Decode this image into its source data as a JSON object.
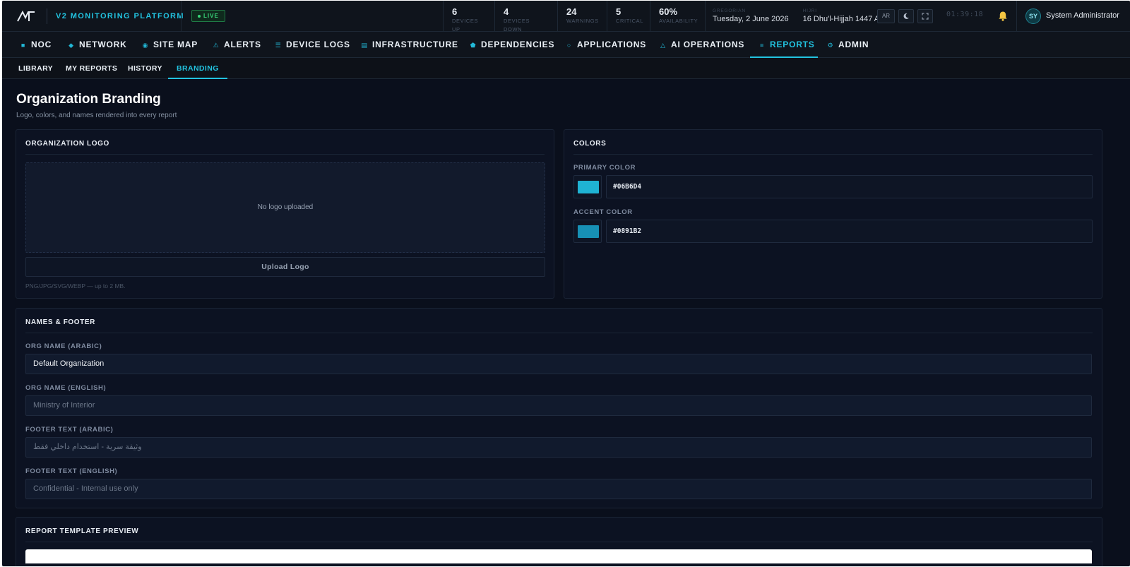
{
  "header": {
    "brand": "V2 MONITORING PLATFORM",
    "live_label": "LIVE",
    "stats": [
      {
        "value": "6",
        "label": "DEVICES UP"
      },
      {
        "value": "4",
        "label": "DEVICES DOWN"
      },
      {
        "value": "24",
        "label": "WARNINGS"
      },
      {
        "value": "5",
        "label": "CRITICAL"
      },
      {
        "value": "60%",
        "label": "AVAILABILITY"
      }
    ],
    "gregorian_label": "GREGORIAN",
    "gregorian_date": "Tuesday, 2 June 2026",
    "hijri_label": "HIJRI",
    "hijri_date": "16 Dhu'l-Hijjah 1447 AH",
    "lang_button": "AR",
    "clock": "01:39:18",
    "avatar_initials": "SY",
    "user_name": "System Administrator"
  },
  "nav": {
    "items": [
      {
        "label": "NOC",
        "icon": "square-icon"
      },
      {
        "label": "NETWORK",
        "icon": "diamond-icon"
      },
      {
        "label": "SITE MAP",
        "icon": "target-icon"
      },
      {
        "label": "ALERTS",
        "icon": "warning-icon"
      },
      {
        "label": "DEVICE LOGS",
        "icon": "list-icon"
      },
      {
        "label": "INFRASTRUCTURE",
        "icon": "server-icon"
      },
      {
        "label": "DEPENDENCIES",
        "icon": "pentagon-icon"
      },
      {
        "label": "APPLICATIONS",
        "icon": "circle-icon"
      },
      {
        "label": "AI OPERATIONS",
        "icon": "triangle-icon"
      },
      {
        "label": "REPORTS",
        "icon": "report-icon"
      },
      {
        "label": "ADMIN",
        "icon": "gear-icon"
      }
    ],
    "active": "REPORTS"
  },
  "subnav": {
    "items": [
      "LIBRARY",
      "MY REPORTS",
      "HISTORY",
      "BRANDING"
    ],
    "active": "BRANDING"
  },
  "page": {
    "title": "Organization Branding",
    "subtitle": "Logo, colors, and names rendered into every report"
  },
  "logo_card": {
    "heading": "ORGANIZATION LOGO",
    "empty_text": "No logo uploaded",
    "upload_label": "Upload Logo",
    "hint": "PNG/JPG/SVG/WEBP — up to 2 MB."
  },
  "colors_card": {
    "heading": "COLORS",
    "primary_label": "PRIMARY COLOR",
    "primary_value": "#06B6D4",
    "accent_label": "ACCENT COLOR",
    "accent_value": "#0891B2"
  },
  "names_card": {
    "heading": "NAMES & FOOTER",
    "org_ar_label": "ORG NAME (ARABIC)",
    "org_ar_value": "Default Organization",
    "org_en_label": "ORG NAME (ENGLISH)",
    "org_en_placeholder": "Ministry of Interior",
    "footer_ar_label": "FOOTER TEXT (ARABIC)",
    "footer_ar_placeholder": "وثيقة سرية - استخدام داخلي فقط",
    "footer_en_label": "FOOTER TEXT (ENGLISH)",
    "footer_en_placeholder": "Confidential - Internal use only"
  },
  "preview_card": {
    "heading": "REPORT TEMPLATE PREVIEW"
  },
  "theme": {
    "accent": "#22C3E0",
    "background": "#0A0F1C",
    "live_green": "#39D67A"
  }
}
